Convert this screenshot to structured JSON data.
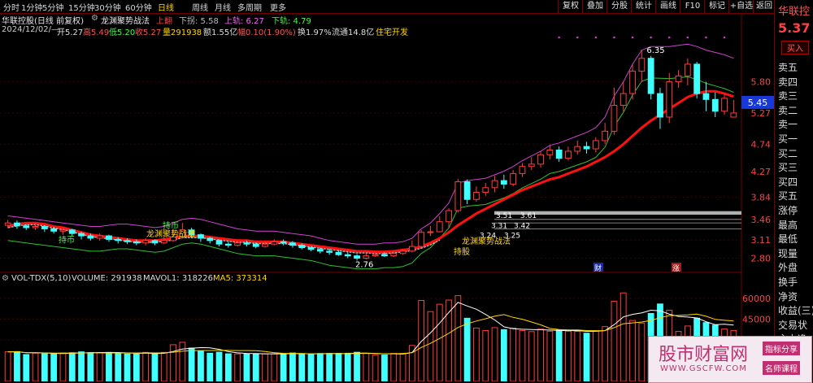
{
  "toolbar": {
    "periods": [
      "分时",
      "1分钟",
      "5分钟",
      "15分钟",
      "30分钟",
      "60分钟",
      "日线",
      "周线",
      "月线",
      "多周期",
      "更多"
    ],
    "active": "日线",
    "right_buttons": [
      "复权",
      "叠加",
      "分股",
      "统计",
      "画线",
      "F10",
      "标记",
      "+自选",
      "返回"
    ]
  },
  "info": {
    "title": "华联控股(日线 前复权)",
    "indicator_name": "龙渊聚势战法",
    "up_label": "上翻",
    "down_turn": "下拐: 5.58",
    "upper_track": "上轨: 6.27",
    "lower_track": "下轨: 4.79",
    "date": "2024/12/02/—",
    "open": "开5.27",
    "high": "高5.49",
    "low": "低5.20",
    "close": "收5.27",
    "volume": "量291938",
    "amount": "额1.55亿",
    "change": "幅0.10(1.90%)",
    "turnover": "换1.97%",
    "float_cap": "流通14.8亿",
    "sector": "住宅开发"
  },
  "vol_header": {
    "name": "VOL-TDX(5,10)",
    "volume": "VOLUME: 291938",
    "mavol1": "MAVOL1: 318226",
    "ma5": "MA5: 373314"
  },
  "price_axis": [
    "5.80",
    "5.27",
    "4.74",
    "4.27",
    "3.84",
    "3.46",
    "3.11",
    "2.80"
  ],
  "price_marker": "5.45",
  "vol_axis": [
    "60000",
    "45000",
    "30000"
  ],
  "annotations": {
    "peak": "6.35",
    "low": "2.76",
    "lv1": "3.51",
    "lv2": "3.61",
    "lv3": "3.31",
    "lv4": "3.42",
    "lv5": "3.24",
    "lv6": "3.25",
    "chi_bi_1": "持币",
    "chi_bi_2": "持币",
    "chi_gu": "持股",
    "signal_1": "龙渊聚势战法",
    "signal_2": "龙渊聚势战法",
    "cai": "财",
    "zhang": "涨"
  },
  "right_panel": {
    "name": "华联控",
    "price": "5.37",
    "buy_btn": "买入",
    "rows": [
      "卖五",
      "卖四",
      "卖三",
      "卖二",
      "卖一",
      "买一",
      "买二",
      "买三",
      "买四",
      "买五",
      "涨停",
      "最高",
      "最低",
      "现量",
      "外盘",
      "换手",
      "净资",
      "收益(三)",
      "交易状",
      "主力净"
    ]
  },
  "watermark": {
    "site": "股市财富网",
    "url": "WWW.GSCFW.COM",
    "tag1": "指标分享",
    "tag2": "名师课程"
  },
  "colors": {
    "up": "#ff3c3c",
    "down": "#40ffff",
    "ma_red": "#ff1010",
    "boll": "#d040d0",
    "lower": "#30c030",
    "band": "#b0b0b0"
  },
  "chart_data": {
    "type": "candlestick",
    "date_last": "2024/12/02",
    "ylim": [
      2.6,
      6.5
    ],
    "candles": [
      [
        3.36,
        3.4,
        3.45,
        3.31
      ],
      [
        3.4,
        3.35,
        3.44,
        3.3
      ],
      [
        3.35,
        3.32,
        3.38,
        3.28
      ],
      [
        3.32,
        3.34,
        3.4,
        3.28
      ],
      [
        3.34,
        3.3,
        3.36,
        3.25
      ],
      [
        3.3,
        3.26,
        3.33,
        3.22
      ],
      [
        3.26,
        3.28,
        3.32,
        3.2
      ],
      [
        3.28,
        3.22,
        3.3,
        3.18
      ],
      [
        3.22,
        3.18,
        3.25,
        3.12
      ],
      [
        3.18,
        3.14,
        3.22,
        3.1
      ],
      [
        3.14,
        3.18,
        3.22,
        3.1
      ],
      [
        3.18,
        3.12,
        3.2,
        3.08
      ],
      [
        3.12,
        3.1,
        3.16,
        3.05
      ],
      [
        3.1,
        3.08,
        3.14,
        3.04
      ],
      [
        3.08,
        3.06,
        3.12,
        3.02
      ],
      [
        3.06,
        3.1,
        3.14,
        3.02
      ],
      [
        3.1,
        3.06,
        3.12,
        3.02
      ],
      [
        3.06,
        3.1,
        3.16,
        3.04
      ],
      [
        3.1,
        3.16,
        3.3,
        3.08
      ],
      [
        3.16,
        3.28,
        3.4,
        3.14
      ],
      [
        3.28,
        3.2,
        3.32,
        3.14
      ],
      [
        3.2,
        3.14,
        3.22,
        3.08
      ],
      [
        3.14,
        3.1,
        3.16,
        3.05
      ],
      [
        3.1,
        3.04,
        3.12,
        3.0
      ],
      [
        3.04,
        3.02,
        3.08,
        2.98
      ],
      [
        3.02,
        3.06,
        3.1,
        3.0
      ],
      [
        3.06,
        3.04,
        3.1,
        3.0
      ],
      [
        3.04,
        3.0,
        3.07,
        2.97
      ],
      [
        3.0,
        3.04,
        3.08,
        2.98
      ],
      [
        3.04,
        3.08,
        3.12,
        3.02
      ],
      [
        3.08,
        3.06,
        3.12,
        3.02
      ],
      [
        3.06,
        3.02,
        3.09,
        2.98
      ],
      [
        3.02,
        2.98,
        3.05,
        2.95
      ],
      [
        2.98,
        2.95,
        3.01,
        2.92
      ],
      [
        2.95,
        2.92,
        2.98,
        2.88
      ],
      [
        2.92,
        2.9,
        2.96,
        2.86
      ],
      [
        2.9,
        2.86,
        2.94,
        2.84
      ],
      [
        2.86,
        2.84,
        2.9,
        2.8
      ],
      [
        2.84,
        2.8,
        2.87,
        2.76
      ],
      [
        2.8,
        2.84,
        2.88,
        2.78
      ],
      [
        2.84,
        2.86,
        2.9,
        2.82
      ],
      [
        2.86,
        2.84,
        2.9,
        2.82
      ],
      [
        2.84,
        2.88,
        2.92,
        2.82
      ],
      [
        2.88,
        2.92,
        2.96,
        2.86
      ],
      [
        2.92,
        3.0,
        3.1,
        2.9
      ],
      [
        3.0,
        3.24,
        3.28,
        2.98
      ],
      [
        3.24,
        3.25,
        3.35,
        3.18
      ],
      [
        3.25,
        3.42,
        3.51,
        3.24
      ],
      [
        3.42,
        3.61,
        3.65,
        3.31
      ],
      [
        3.61,
        4.1,
        4.15,
        3.58
      ],
      [
        4.1,
        3.8,
        4.14,
        3.72
      ],
      [
        3.8,
        3.92,
        4.02,
        3.76
      ],
      [
        3.92,
        4.0,
        4.08,
        3.86
      ],
      [
        4.0,
        4.12,
        4.2,
        3.92
      ],
      [
        4.12,
        4.06,
        4.22,
        3.98
      ],
      [
        4.06,
        4.24,
        4.3,
        4.02
      ],
      [
        4.24,
        4.36,
        4.42,
        4.18
      ],
      [
        4.36,
        4.4,
        4.52,
        4.3
      ],
      [
        4.4,
        4.56,
        4.62,
        4.34
      ],
      [
        4.56,
        4.64,
        4.72,
        4.48
      ],
      [
        4.64,
        4.5,
        4.7,
        4.44
      ],
      [
        4.5,
        4.62,
        4.7,
        4.46
      ],
      [
        4.62,
        4.7,
        4.8,
        4.56
      ],
      [
        4.7,
        4.66,
        4.78,
        4.58
      ],
      [
        4.66,
        4.8,
        4.86,
        4.6
      ],
      [
        4.8,
        4.96,
        5.1,
        4.74
      ],
      [
        4.96,
        5.4,
        5.7,
        4.9
      ],
      [
        5.4,
        5.6,
        5.8,
        5.3
      ],
      [
        5.6,
        5.98,
        6.1,
        5.5
      ],
      [
        5.98,
        6.2,
        6.35,
        5.8
      ],
      [
        6.2,
        5.6,
        6.24,
        5.5
      ],
      [
        5.6,
        5.2,
        5.7,
        5.0
      ],
      [
        5.2,
        5.8,
        5.95,
        5.1
      ],
      [
        5.8,
        5.9,
        6.0,
        5.7
      ],
      [
        5.9,
        6.1,
        6.2,
        5.74
      ],
      [
        6.1,
        5.6,
        6.14,
        5.52
      ],
      [
        5.6,
        5.5,
        5.8,
        5.3
      ],
      [
        5.5,
        5.3,
        5.62,
        5.2
      ],
      [
        5.3,
        5.52,
        5.58,
        5.24
      ],
      [
        5.2,
        5.27,
        5.49,
        5.2
      ]
    ],
    "ma_red": [
      3.35,
      3.38,
      3.4,
      3.4,
      3.38,
      3.34,
      3.32,
      3.28,
      3.24,
      3.2,
      3.18,
      3.16,
      3.14,
      3.12,
      3.1,
      3.1,
      3.1,
      3.12,
      3.14,
      3.18,
      3.18,
      3.18,
      3.16,
      3.14,
      3.12,
      3.1,
      3.1,
      3.08,
      3.08,
      3.08,
      3.08,
      3.06,
      3.04,
      3.02,
      3.0,
      2.98,
      2.96,
      2.94,
      2.92,
      2.92,
      2.91,
      2.91,
      2.92,
      2.94,
      2.96,
      3.0,
      3.06,
      3.14,
      3.24,
      3.36,
      3.46,
      3.56,
      3.64,
      3.72,
      3.8,
      3.88,
      3.96,
      4.02,
      4.08,
      4.14,
      4.18,
      4.24,
      4.3,
      4.36,
      4.44,
      4.52,
      4.62,
      4.74,
      4.88,
      5.02,
      5.14,
      5.24,
      5.34,
      5.44,
      5.54,
      5.6,
      5.64,
      5.64,
      5.6,
      5.55
    ],
    "boll_upper": [
      3.52,
      3.5,
      3.48,
      3.46,
      3.44,
      3.42,
      3.4,
      3.38,
      3.36,
      3.34,
      3.34,
      3.36,
      3.38,
      3.38,
      3.36,
      3.34,
      3.32,
      3.34,
      3.4,
      3.46,
      3.48,
      3.46,
      3.42,
      3.38,
      3.34,
      3.3,
      3.28,
      3.26,
      3.26,
      3.26,
      3.24,
      3.22,
      3.2,
      3.18,
      3.14,
      3.1,
      3.08,
      3.06,
      3.04,
      3.04,
      3.04,
      3.06,
      3.06,
      3.08,
      3.14,
      3.3,
      3.4,
      3.56,
      3.74,
      4.08,
      4.12,
      4.14,
      4.16,
      4.22,
      4.28,
      4.36,
      4.46,
      4.54,
      4.62,
      4.72,
      4.76,
      4.82,
      4.88,
      4.94,
      5.02,
      5.2,
      5.56,
      5.8,
      6.1,
      6.34,
      6.4,
      6.4,
      6.4,
      6.42,
      6.44,
      6.4,
      6.34,
      6.3,
      6.26,
      6.2
    ]
  }
}
